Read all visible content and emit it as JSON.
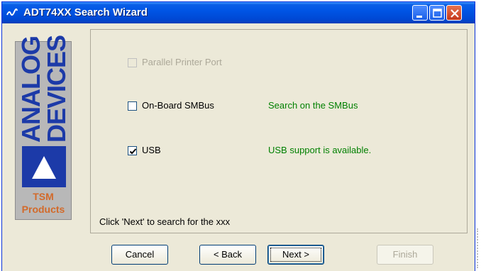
{
  "window": {
    "title": "ADT74XX Search Wizard",
    "icon": "analog-devices-wave-icon",
    "controls": {
      "minimize": "minimize-icon",
      "maximize": "maximize-icon",
      "close": "close-icon"
    }
  },
  "logo": {
    "line1": "ANALOG",
    "line2": "DEVICES",
    "tsm_line1": "TSM",
    "tsm_line2": "Products",
    "colors": {
      "brand_blue": "#1c3aa8",
      "tsm_orange": "#d26a2a",
      "background": "#b8b8b8"
    }
  },
  "options": [
    {
      "label": "Parallel Printer Port",
      "checked": false,
      "enabled": false,
      "status": ""
    },
    {
      "label": "On-Board SMBus",
      "checked": false,
      "enabled": true,
      "status": "Search on the SMBus"
    },
    {
      "label": "USB",
      "checked": true,
      "enabled": true,
      "status": "USB support is available."
    }
  ],
  "hint": "Click 'Next' to search for  the xxx",
  "buttons": {
    "cancel": "Cancel",
    "back": "< Back",
    "next": "Next >",
    "finish": "Finish"
  },
  "colors": {
    "status_green": "#008000",
    "titlebar": "#0055e5",
    "dialog_bg": "#ece9d8"
  }
}
